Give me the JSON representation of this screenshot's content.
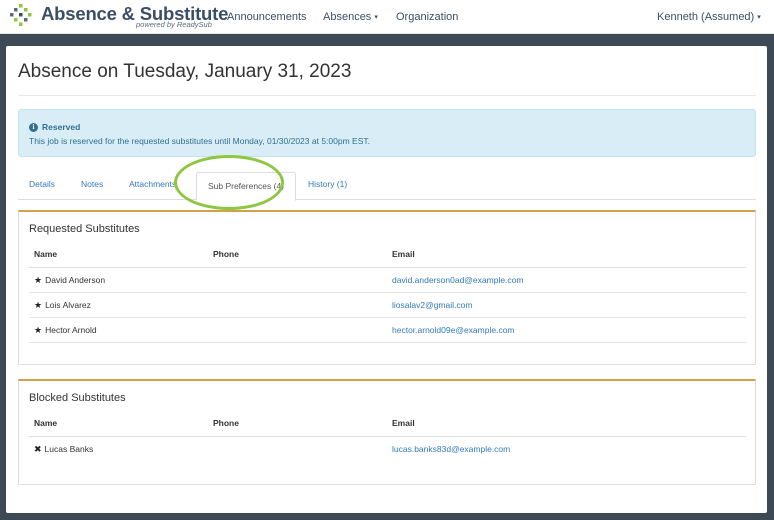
{
  "navbar": {
    "brand": "Absence & Substitute",
    "brand_sub": "powered by ReadySub",
    "links": [
      "Announcements",
      "Absences",
      "Organization"
    ],
    "user": "Kenneth (Assumed)",
    "caret": "▾"
  },
  "page": {
    "title": "Absence on Tuesday, January 31, 2023"
  },
  "alert": {
    "icon": "info-icon",
    "title": "Reserved",
    "text": "This job is reserved for the requested substitutes until Monday, 01/30/2023 at 5:00pm EST."
  },
  "tabs": [
    "Details",
    "Notes",
    "Attachments",
    "Sub Preferences (4)",
    "History (1)"
  ],
  "active_tab": "Sub Preferences (4)",
  "columns": {
    "name": "Name",
    "phone": "Phone",
    "email": "Email"
  },
  "requested": {
    "title": "Requested Substitutes",
    "mark": "★",
    "rows": [
      {
        "name": "David Anderson",
        "phone": "",
        "email": "david.anderson0ad@example.com"
      },
      {
        "name": "Lois Alvarez",
        "phone": "",
        "email": "liosalav2@gmail.com"
      },
      {
        "name": "Hector Arnold",
        "phone": "",
        "email": "hector.arnold09e@example.com"
      }
    ]
  },
  "blocked": {
    "title": "Blocked Substitutes",
    "mark": "✖",
    "rows": [
      {
        "name": "Lucas Banks",
        "phone": "",
        "email": "lucas.banks83d@example.com"
      }
    ]
  },
  "colors": {
    "link": "#337ab7",
    "alert_bg": "#d9edf7",
    "panel_accent": "#d4a04a",
    "highlight": "#8dc63f",
    "brand": "#3a4f66"
  }
}
